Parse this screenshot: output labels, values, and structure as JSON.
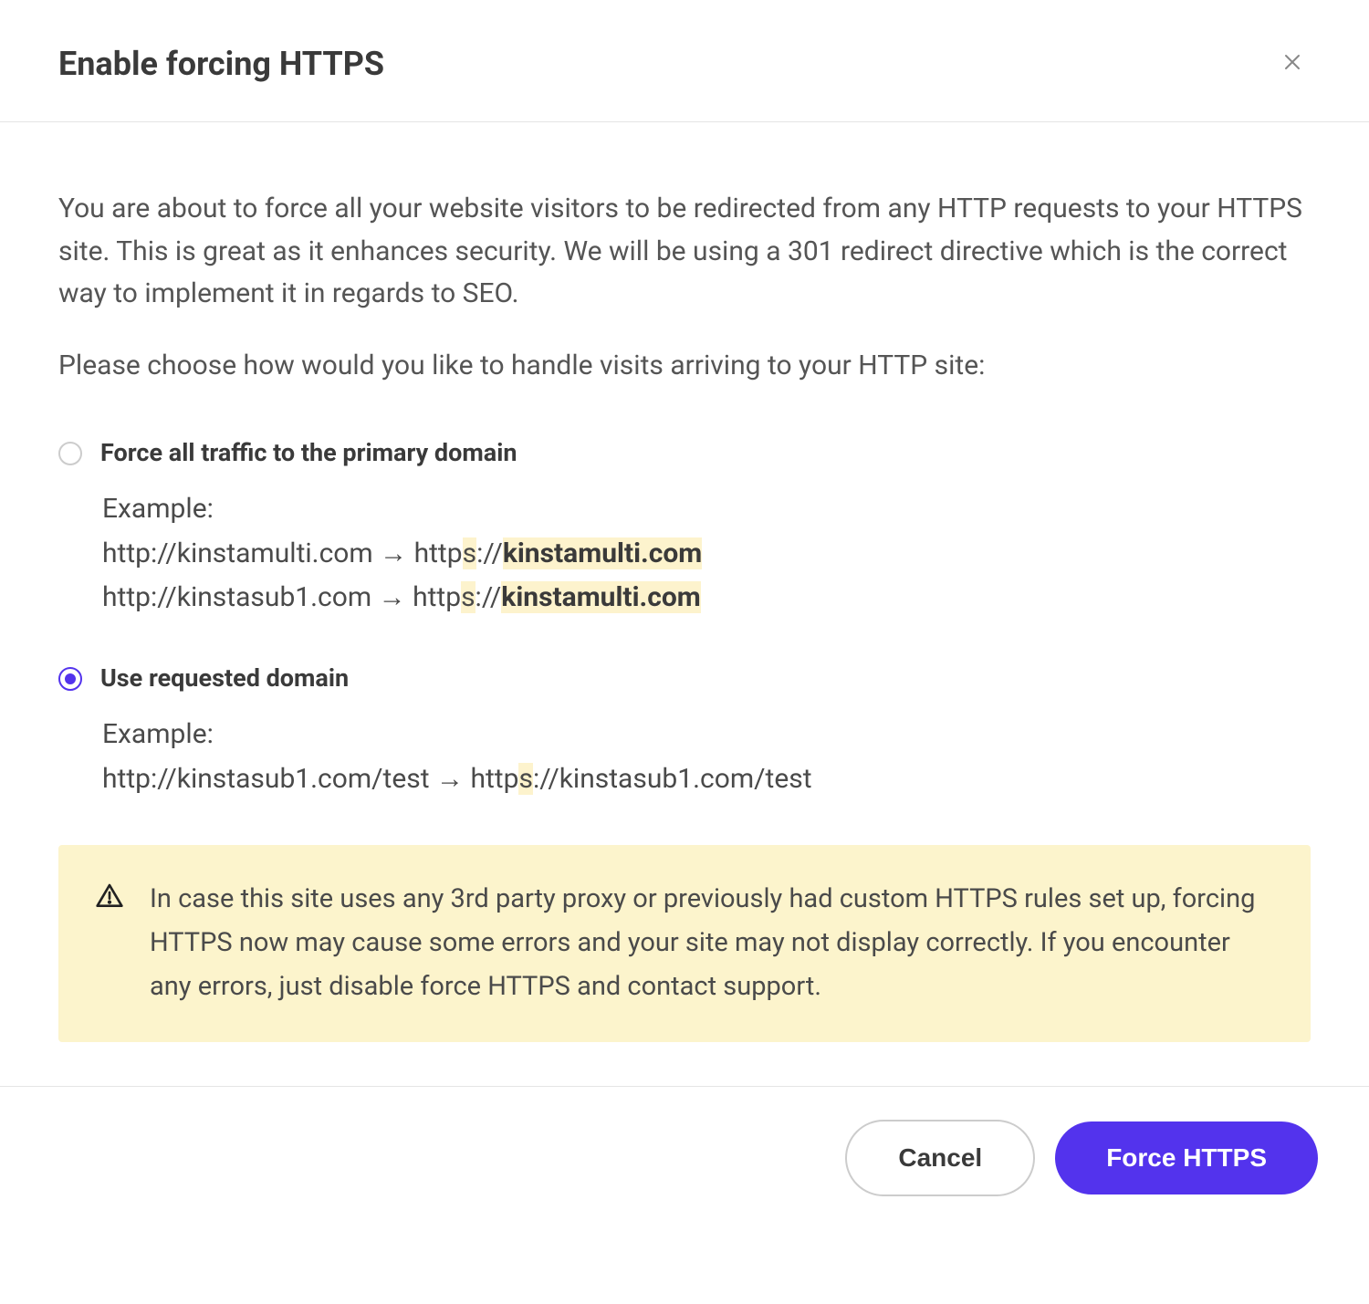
{
  "header": {
    "title": "Enable forcing HTTPS"
  },
  "body": {
    "description": "You are about to force all your website visitors to be redirected from any HTTP requests to your HTTPS site. This is great as it enhances security. We will be using a 301 redirect directive which is the correct way to implement it in regards to SEO.",
    "subdescription": "Please choose how would you like to handle visits arriving to your HTTP site:"
  },
  "options": {
    "primary": {
      "label": "Force all traffic to the primary domain",
      "example_label": "Example:",
      "example1_prefix": "http://kinstamulti.com → http",
      "example1_s": "s",
      "example1_mid": "://",
      "example1_domain": "kinstamulti.com",
      "example2_prefix": "http://kinstasub1.com → http",
      "example2_s": "s",
      "example2_mid": "://",
      "example2_domain": "kinstamulti.com"
    },
    "requested": {
      "label": "Use requested domain",
      "example_label": "Example:",
      "example1_prefix": "http://kinstasub1.com/test → http",
      "example1_s": "s",
      "example1_suffix": "://kinstasub1.com/test"
    }
  },
  "warning": {
    "text": "In case this site uses any 3rd party proxy or previously had custom HTTPS rules set up, forcing HTTPS now may cause some errors and your site may not display correctly. If you encounter any errors, just disable force HTTPS and contact support."
  },
  "footer": {
    "cancel_label": "Cancel",
    "confirm_label": "Force HTTPS"
  }
}
